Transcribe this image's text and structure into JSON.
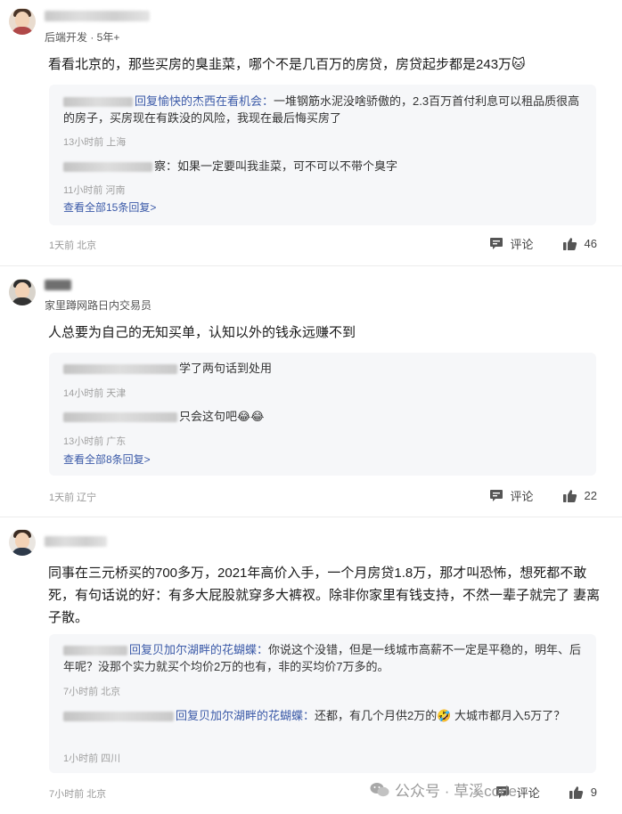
{
  "comments": [
    {
      "user_meta": "后端开发 · 5年+",
      "text": "看看北京的，那些买房的臭韭菜，哪个不是几百万的房贷，房贷起步都是243万🐱",
      "replies": [
        {
          "target": "回复愉快的杰西在看机会：",
          "text": "一堆钢筋水泥没啥骄傲的，2.3百万首付利息可以租品质很高的房子，买房现在有跌没的风险，我现在最后悔买房了",
          "meta": "13小时前 上海"
        },
        {
          "target": "",
          "text": "察：如果一定要叫我韭菜，可不可以不带个臭字",
          "meta": "11小时前 河南"
        }
      ],
      "view_all": "查看全部15条回复>",
      "footer_meta": "1天前 北京",
      "comment_label": "评论",
      "likes": "46"
    },
    {
      "user_meta": "家里蹲网路日内交易员",
      "text": "人总要为自己的无知买单，认知以外的钱永远赚不到",
      "replies": [
        {
          "target": "",
          "text": "学了两句话到处用",
          "meta": "14小时前 天津"
        },
        {
          "target": "",
          "text": "只会这句吧😂😂",
          "meta": "13小时前 广东"
        }
      ],
      "view_all": "查看全部8条回复>",
      "footer_meta": "1天前 辽宁",
      "comment_label": "评论",
      "likes": "22"
    },
    {
      "user_meta": "",
      "text": "同事在三元桥买的700多万，2021年高价入手，一个月房贷1.8万，那才叫恐怖，想死都不敢死，有句话说的好：有多大屁股就穿多大裤衩。除非你家里有钱支持，不然一辈子就完了 妻离子散。",
      "replies": [
        {
          "target": "回复贝加尔湖畔的花蝴蝶：",
          "text": "你说这个没错，但是一线城市高薪不一定是平稳的，明年、后年呢？没那个实力就买个均价2万的也有，非的买均价7万多的。",
          "meta": "7小时前 北京"
        },
        {
          "target": "回复贝加尔湖畔的花蝴蝶：",
          "text": "还都，有几个月供2万的🤣 大城市都月入5万了？",
          "meta": "1小时前 四川"
        }
      ],
      "view_all": "",
      "footer_meta": "7小时前 北京",
      "comment_label": "评论",
      "likes": "9"
    }
  ],
  "watermark": "公众号 · 草溪code",
  "colors": {
    "link": "#3b5aa8",
    "reply_bg": "#f6f7f9",
    "meta": "#999999"
  },
  "icons": [
    "comment-icon",
    "thumbs-up-icon",
    "wechat-icon"
  ]
}
